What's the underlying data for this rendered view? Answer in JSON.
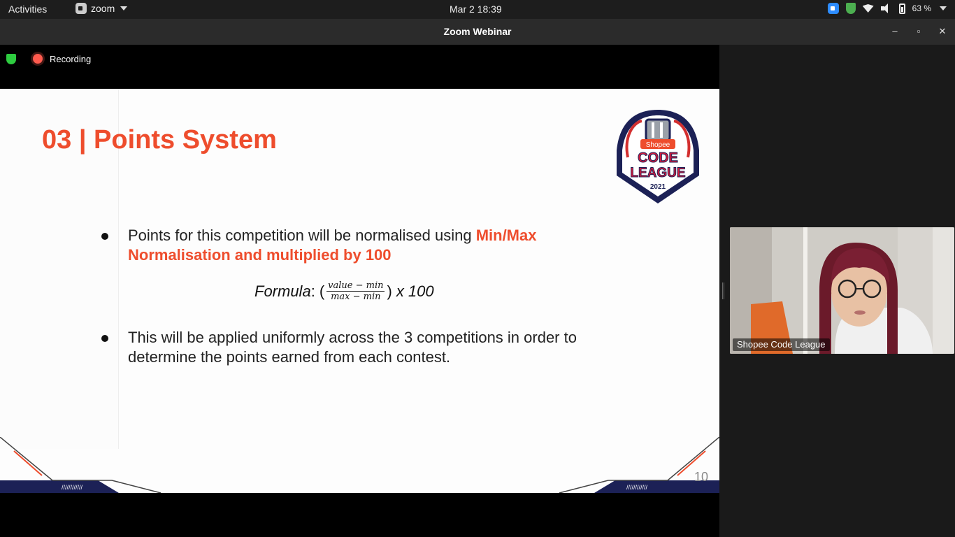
{
  "topbar": {
    "activities": "Activities",
    "app_name": "zoom",
    "clock": "Mar 2  18:39",
    "battery": "63 %"
  },
  "window": {
    "title": "Zoom Webinar",
    "minimize": "–",
    "maximize": "▫",
    "close": "✕"
  },
  "meeting": {
    "recording_label": "Recording"
  },
  "slide": {
    "title": "03 | Points System",
    "bullet1_plain": "Points for this competition will be normalised using ",
    "bullet1_accent": "Min/Max Normalisation and multiplied by 100",
    "formula_label": "Formula",
    "formula_colon": ":",
    "formula_numerator": "value − min",
    "formula_denominator": "max − min",
    "formula_tail": "x 100",
    "bullet2": "This will be applied uniformly across the 3 competitions in order to determine the points earned from each contest.",
    "page_number": "10",
    "logo": {
      "brand": "Shopee",
      "line1": "CODE",
      "line2": "LEAGUE",
      "year": "2021"
    }
  },
  "participant": {
    "name": "Shopee Code League"
  },
  "colors": {
    "accent": "#ee4d2d",
    "topbar": "#1d1d1d",
    "titlebar": "#2b2b2b",
    "sidebar": "#1a1a1a",
    "navy": "#1c2156"
  }
}
